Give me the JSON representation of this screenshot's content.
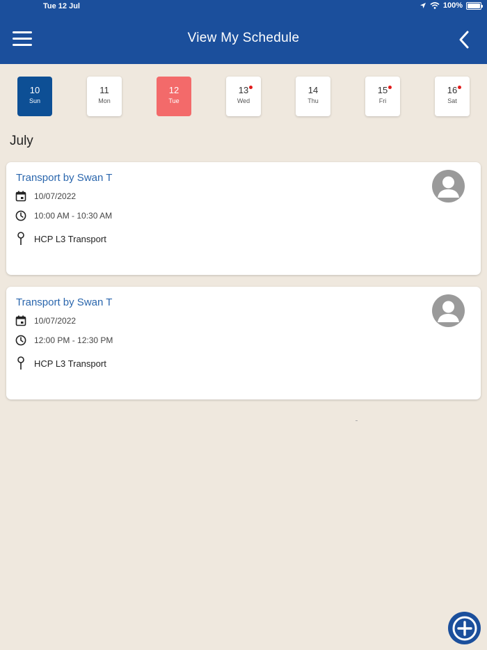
{
  "status_bar": {
    "time": "Tue 12 Jul",
    "battery": "100%"
  },
  "header": {
    "title": "View My Schedule"
  },
  "dates": [
    {
      "num": "10",
      "dow": "Sun",
      "state": "blue",
      "dot": false
    },
    {
      "num": "11",
      "dow": "Mon",
      "state": "",
      "dot": false
    },
    {
      "num": "12",
      "dow": "Tue",
      "state": "red",
      "dot": false
    },
    {
      "num": "13",
      "dow": "Wed",
      "state": "",
      "dot": true
    },
    {
      "num": "14",
      "dow": "Thu",
      "state": "",
      "dot": false
    },
    {
      "num": "15",
      "dow": "Fri",
      "state": "",
      "dot": true
    },
    {
      "num": "16",
      "dow": "Sat",
      "state": "",
      "dot": true
    }
  ],
  "month": "July",
  "appointments": [
    {
      "title": "Transport by Swan T",
      "date": "10/07/2022",
      "time": "10:00 AM - 10:30 AM",
      "location": "HCP L3 Transport"
    },
    {
      "title": "Transport by Swan T",
      "date": "10/07/2022",
      "time": "12:00 PM - 12:30 PM",
      "location": "HCP L3 Transport"
    }
  ],
  "colors": {
    "header": "#1b4f9c",
    "selected_blue": "#0d4f95",
    "selected_red": "#f36a6a",
    "event_dot": "#e01b1b",
    "background": "#efe8de"
  }
}
